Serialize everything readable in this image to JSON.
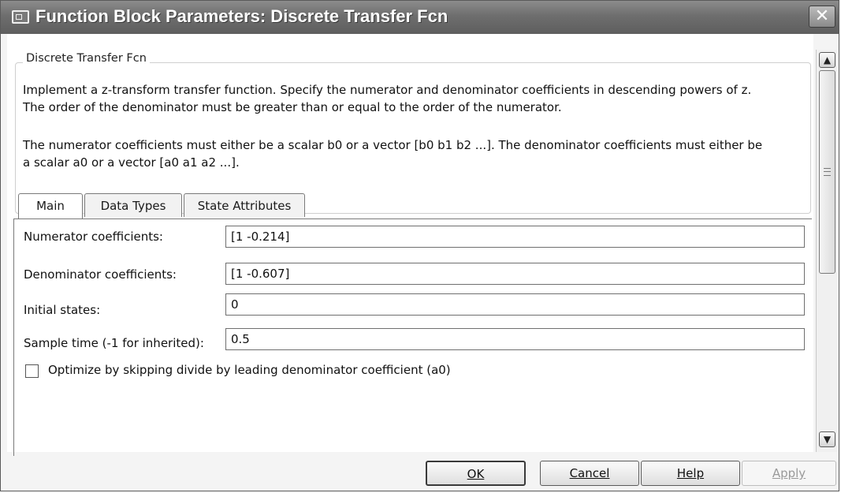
{
  "window": {
    "title": "Function Block Parameters: Discrete Transfer Fcn"
  },
  "description": {
    "group_title": "Discrete Transfer Fcn",
    "line1": "Implement a z-transform transfer function. Specify the numerator and denominator coefficients in descending powers of z.",
    "line2": "The order of the denominator must be greater than or equal to the order of the numerator.",
    "line3": "The numerator coefficients must either be a scalar b0 or a vector [b0 b1 b2 ...]. The denominator coefficients must either be",
    "line4": "a scalar a0 or a vector [a0 a1 a2 ...]."
  },
  "tabs": [
    {
      "label": "Main",
      "active": true
    },
    {
      "label": "Data Types",
      "active": false
    },
    {
      "label": "State Attributes",
      "active": false
    }
  ],
  "parameters": [
    {
      "label": "Numerator coefficients:",
      "value": "[1 -0.214]"
    },
    {
      "label": "Denominator coefficients:",
      "value": "[1 -0.607]"
    },
    {
      "label": "Initial states:",
      "value": "0"
    },
    {
      "label": "Sample time (-1 for inherited):",
      "value": "0.5"
    }
  ],
  "option": {
    "label": "Optimize by skipping divide by leading denominator coefficient (a0)",
    "checked": false
  },
  "buttons": {
    "ok": "OK",
    "cancel": "Cancel",
    "help": "Help",
    "apply": "Apply"
  },
  "icons": {
    "app": "block-dialog-icon",
    "close": "close-icon",
    "scroll_up": "chevron-up-icon",
    "scroll_down": "chevron-down-icon"
  }
}
